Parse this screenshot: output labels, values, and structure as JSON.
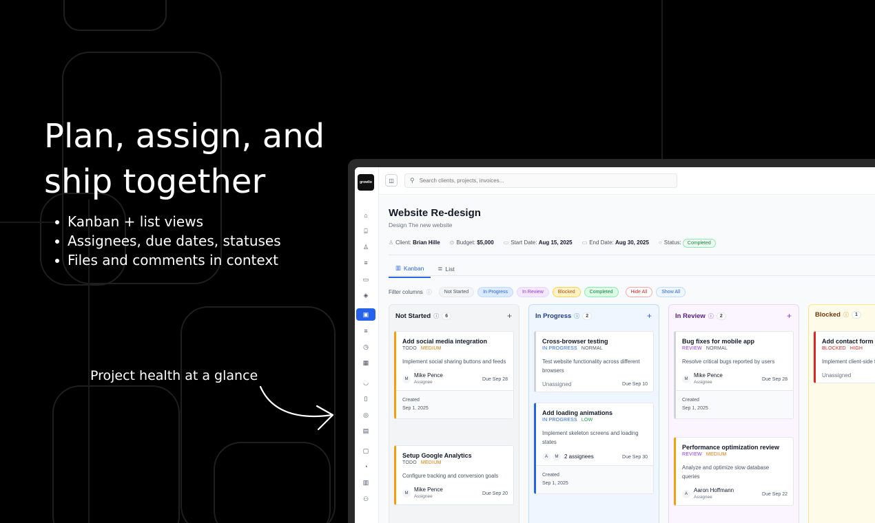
{
  "hero": {
    "title": "Plan, assign, and ship together",
    "bullets": [
      "Kanban + list views",
      "Assignees, due dates, statuses",
      "Files and comments in context"
    ],
    "callout": "Project health at a glance"
  },
  "app": {
    "logo": "growlio",
    "search": {
      "placeholder": "Search clients, projects, invoices..."
    },
    "project": {
      "title": "Website Re-design",
      "subtitle": "Design The new website",
      "client_label": "Client:",
      "client": "Brian Hille",
      "budget_label": "Budget:",
      "budget": "$5,000",
      "start_label": "Start Date:",
      "start": "Aug 15, 2025",
      "end_label": "End Date:",
      "end": "Aug 30, 2025",
      "status_label": "Status:",
      "status": "Completed"
    },
    "tabs": [
      {
        "label": "Kanban",
        "active": true
      },
      {
        "label": "List",
        "active": false
      }
    ],
    "filters": {
      "label": "Filter columns",
      "chips": [
        "Not Started",
        "In Progress",
        "In Review",
        "Blocked",
        "Completed"
      ],
      "hide_all": "Hide All",
      "show_all": "Show All"
    },
    "columns": [
      {
        "name": "Not Started",
        "count": "6",
        "color": "#6b7280",
        "cards": [
          {
            "title": "Add social media integration",
            "status": "TODO",
            "priority": "MEDIUM",
            "desc": "Implement social sharing buttons and feeds",
            "avatar": "M",
            "assignee": "Mike Pence",
            "role": "Assignee",
            "due": "Due Sep 28",
            "created_label": "Created",
            "created": "Sep 1, 2025",
            "border": "#f59e0b"
          },
          {
            "title": "Setup Google Analytics",
            "status": "TODO",
            "priority": "MEDIUM",
            "desc": "Configure tracking and conversion goals",
            "avatar": "M",
            "assignee": "Mike Pence",
            "role": "Assignee",
            "due": "Due Sep 20",
            "border": "#f59e0b"
          }
        ]
      },
      {
        "name": "In Progress",
        "count": "2",
        "color": "#2563eb",
        "cards": [
          {
            "title": "Cross-browser testing",
            "status": "IN PROGRESS",
            "priority": "NORMAL",
            "desc": "Test website functionality across different browsers",
            "unassigned": "Unassigned",
            "due": "Due Sep 10",
            "border": "#d1d5db"
          },
          {
            "title": "Add loading animations",
            "status": "IN PROGRESS",
            "priority": "LOW",
            "desc": "Implement skeleton screens and loading states",
            "avatars": [
              "A",
              "M"
            ],
            "assignee": "2 assignees",
            "due": "Due Sep 30",
            "created_label": "Created",
            "created": "Sep 1, 2025",
            "border": "#2563eb"
          }
        ]
      },
      {
        "name": "In Review",
        "count": "2",
        "color": "#9333ea",
        "cards": [
          {
            "title": "Bug fixes for mobile app",
            "status": "REVIEW",
            "priority": "NORMAL",
            "desc": "Resolve critical bugs reported by users",
            "avatar": "M",
            "assignee": "Mike Pence",
            "role": "Assignee",
            "due": "Due Sep 28",
            "created_label": "Created",
            "created": "Sep 1, 2025",
            "border": "#d1d5db"
          },
          {
            "title": "Performance optimization review",
            "status": "REVIEW",
            "priority": "MEDIUM",
            "desc": "Analyze and optimize slow database queries",
            "avatar": "A",
            "assignee": "Aaron Hoffmann",
            "role": "Assignee",
            "due": "Due Sep 22",
            "border": "#f59e0b"
          }
        ]
      },
      {
        "name": "Blocked",
        "count": "1",
        "color": "#d97706",
        "cards": [
          {
            "title": "Add contact form",
            "status": "BLOCKED",
            "priority": "HIGH",
            "desc": "Implement client-side form validation",
            "unassigned": "Unassigned",
            "border": "#dc2626"
          }
        ]
      }
    ]
  }
}
